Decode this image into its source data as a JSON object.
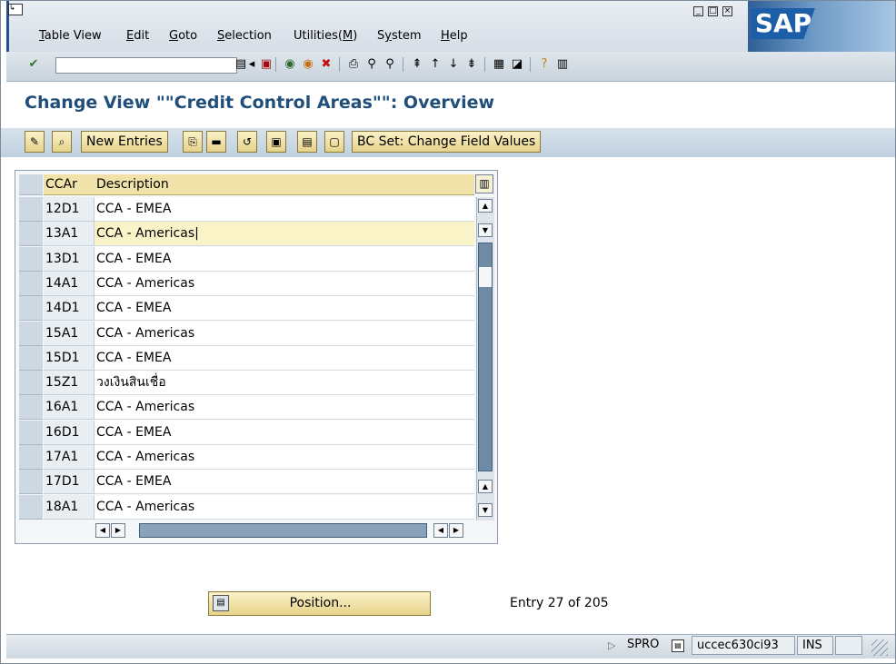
{
  "menu": {
    "items": [
      "Table View",
      "Edit",
      "Goto",
      "Selection",
      "Utilities(M)",
      "System",
      "Help"
    ],
    "underlines": [
      "T",
      "E",
      "G",
      "S",
      "M",
      "y",
      "H"
    ]
  },
  "brand": {
    "logo_text": "SAP",
    "accent": "#1f4f8c"
  },
  "toolbar": {
    "command_value": ""
  },
  "page": {
    "title": "Change View \"\"Credit Control Areas\"\": Overview"
  },
  "app_toolbar": {
    "new_entries": "New Entries",
    "bc_set": "BC Set: Change Field Values"
  },
  "table": {
    "headers": {
      "key": "CCAr",
      "description": "Description"
    },
    "rows": [
      {
        "key": "12D1",
        "description": "CCA - EMEA"
      },
      {
        "key": "13A1",
        "description": "CCA - Americas"
      },
      {
        "key": "13D1",
        "description": "CCA - EMEA"
      },
      {
        "key": "14A1",
        "description": "CCA - Americas"
      },
      {
        "key": "14D1",
        "description": "CCA - EMEA"
      },
      {
        "key": "15A1",
        "description": "CCA - Americas"
      },
      {
        "key": "15D1",
        "description": "CCA - EMEA"
      },
      {
        "key": "15Z1",
        "description": "วงเงินสินเชื่อ"
      },
      {
        "key": "16A1",
        "description": "CCA - Americas"
      },
      {
        "key": "16D1",
        "description": "CCA - EMEA"
      },
      {
        "key": "17A1",
        "description": "CCA - Americas"
      },
      {
        "key": "17D1",
        "description": "CCA - EMEA"
      },
      {
        "key": "18A1",
        "description": "CCA - Americas"
      }
    ],
    "active_row": 1
  },
  "footer": {
    "position_label": "Position...",
    "entry_text": "Entry 27 of 205"
  },
  "status": {
    "transaction": "SPRO",
    "server": "uccec630ci93",
    "mode": "INS"
  }
}
